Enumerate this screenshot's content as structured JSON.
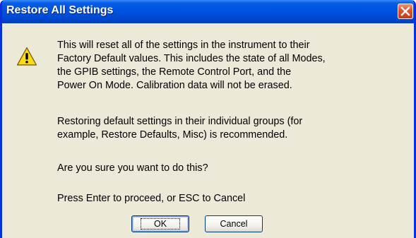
{
  "window": {
    "title": "Restore All Settings",
    "close_icon": "close-icon"
  },
  "icon": {
    "name": "warning-icon",
    "color": "#f5d000"
  },
  "message": {
    "paragraph1": [
      "This will reset all of the settings in the instrument to their",
      "Factory Default values.   This includes the state of all Modes,",
      "the GPIB settings, the Remote Control Port, and the",
      "Power On Mode.  Calibration data will not be erased."
    ],
    "paragraph2": [
      "Restoring default settings in their individual groups (for",
      "example, Restore Defaults, Misc) is recommended."
    ],
    "paragraph3": "Are you sure you want to do this?",
    "paragraph4": "Press Enter to proceed, or ESC to Cancel"
  },
  "buttons": {
    "ok": "OK",
    "cancel": "Cancel"
  },
  "colors": {
    "titlebar": "#0055e5",
    "close_button": "#e2532f",
    "dialog_background": "#ece9d8"
  }
}
